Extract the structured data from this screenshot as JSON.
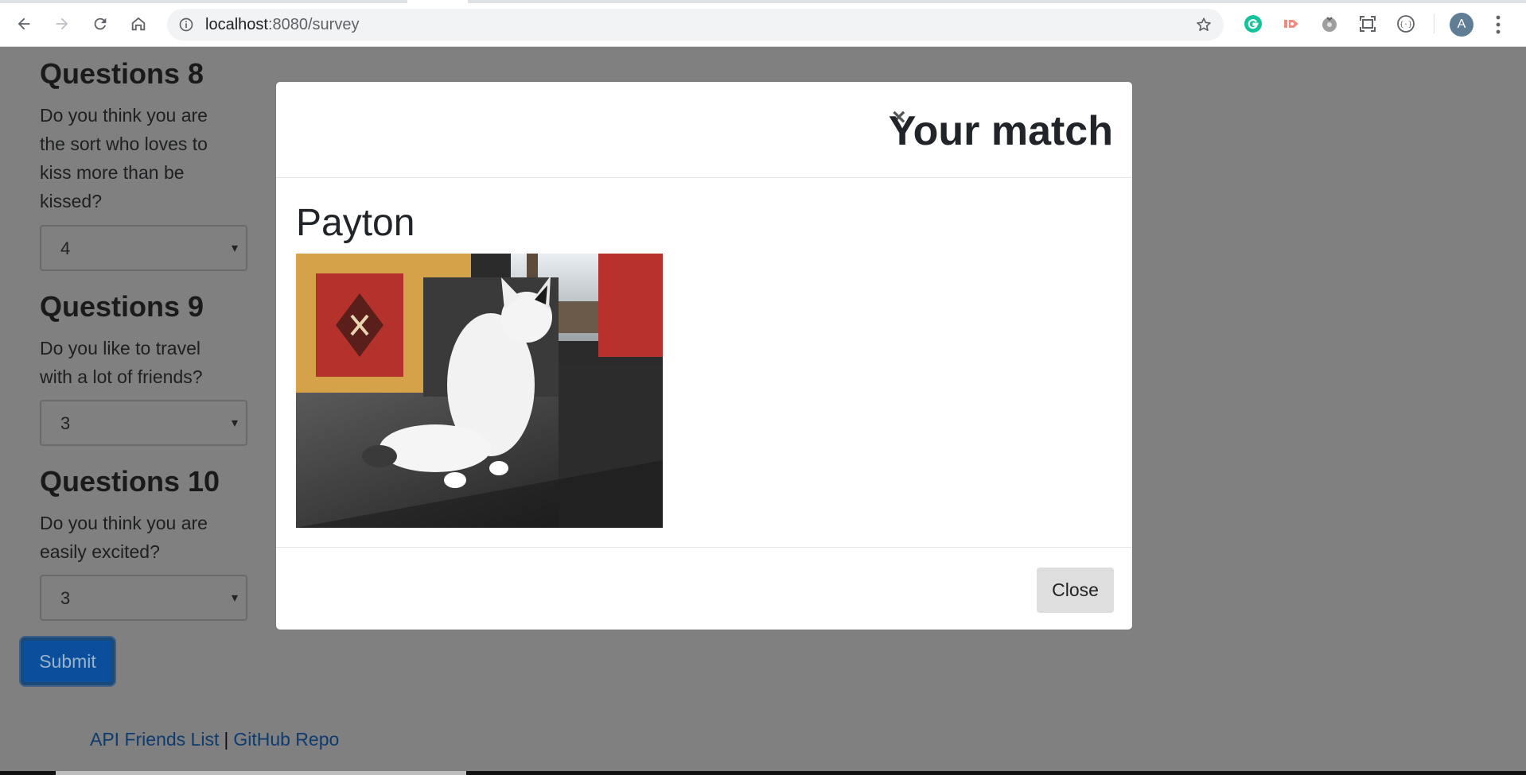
{
  "browser": {
    "url_host": "localhost",
    "url_path": ":8080/survey",
    "avatar_letter": "A",
    "extensions": [
      "grammarly-icon",
      "pushbullet-icon",
      "tomato-timer-icon",
      "screenshot-icon",
      "json-viewer-icon"
    ]
  },
  "survey": {
    "questions": [
      {
        "title": "Questions 8",
        "text": "Do you think you are the sort who loves to kiss more than be kissed?",
        "value": "4"
      },
      {
        "title": "Questions 9",
        "text": "Do you like to travel with a lot of friends?",
        "value": "3"
      },
      {
        "title": "Questions 10",
        "text": "Do you think you are easily excited?",
        "value": "3"
      }
    ],
    "submit_label": "Submit"
  },
  "footer": {
    "link1": "API Friends List",
    "separator": "|",
    "link2": "GitHub Repo"
  },
  "modal": {
    "close_x": "×",
    "title": "Your match",
    "match_name": "Payton",
    "close_label": "Close"
  },
  "colors": {
    "overlay": "#808080",
    "submit": "#0b4f9c",
    "link": "#0d3b6e"
  }
}
